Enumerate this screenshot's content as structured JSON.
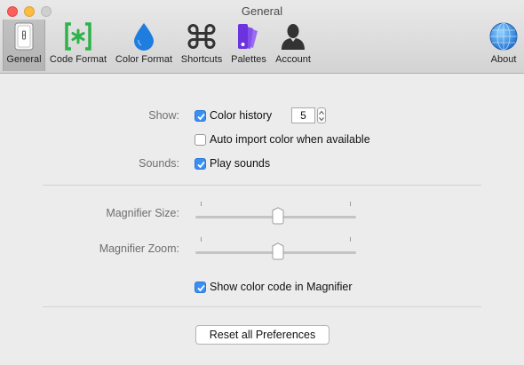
{
  "window": {
    "title": "General"
  },
  "toolbar": {
    "items": [
      {
        "label": "General",
        "icon": "general-switch-icon",
        "selected": true
      },
      {
        "label": "Code Format",
        "icon": "code-brackets-icon",
        "color": "#2db34a"
      },
      {
        "label": "Color Format",
        "icon": "water-drop-icon",
        "color": "#1f7de0"
      },
      {
        "label": "Shortcuts",
        "icon": "command-key-icon",
        "color": "#333333"
      },
      {
        "label": "Palettes",
        "icon": "palette-swatches-icon",
        "color": "#7a3fe4"
      },
      {
        "label": "Account",
        "icon": "user-silhouette-icon",
        "color": "#333333"
      },
      {
        "label": "About",
        "icon": "globe-icon",
        "color": "#2a8ae0"
      }
    ]
  },
  "form": {
    "show_label": "Show:",
    "color_history_label": "Color history",
    "color_history_checked": true,
    "color_history_count": "5",
    "auto_import_label": "Auto import color when available",
    "auto_import_checked": false,
    "sounds_label": "Sounds:",
    "play_sounds_label": "Play sounds",
    "play_sounds_checked": true,
    "magnifier_size_label": "Magnifier Size:",
    "magnifier_size_value": 0.5,
    "magnifier_zoom_label": "Magnifier Zoom:",
    "magnifier_zoom_value": 0.5,
    "show_color_code_label": "Show color code in Magnifier",
    "show_color_code_checked": true,
    "reset_button_label": "Reset all Preferences"
  },
  "colors": {
    "accent": "#3b8ff2",
    "close": "#fc605c",
    "minimize": "#fdbc40"
  }
}
